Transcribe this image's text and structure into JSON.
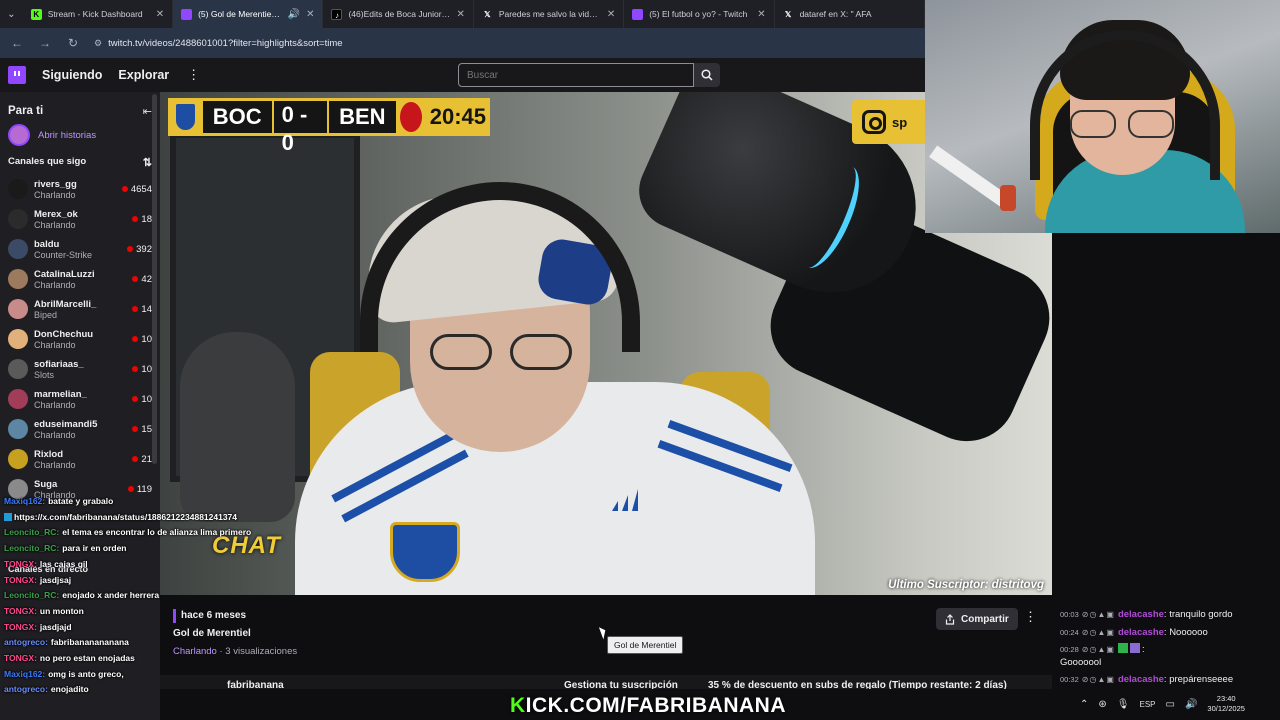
{
  "browser": {
    "tabs": [
      {
        "title": "Stream - Kick Dashboard",
        "icon": "kick-favicon",
        "active": false
      },
      {
        "title": "(5) Gol de Merentiel - Twitch",
        "icon": "twitch-favicon",
        "active": true
      },
      {
        "title": "(46)Edits de Boca Juniors y River",
        "icon": "tiktok-favicon",
        "active": false
      },
      {
        "title": "Paredes me salvo la vida en X: '",
        "icon": "x-favicon",
        "active": false
      },
      {
        "title": "(5) El futbol o yo? - Twitch",
        "icon": "twitch-favicon",
        "active": false
      },
      {
        "title": "dataref en X: \" AFA",
        "icon": "x-favicon",
        "active": false
      }
    ],
    "url": "twitch.tv/videos/2488601001?filter=highlights&sort=time"
  },
  "topnav": {
    "following": "Siguiendo",
    "browse": "Explorar",
    "search_placeholder": "Buscar"
  },
  "sidebar": {
    "for_you": "Para ti",
    "stories": "Abrir historias",
    "followed_header": "Canales que sigo",
    "live_header": "Canales en directo",
    "channels": [
      {
        "name": "rivers_gg",
        "game": "Charlando",
        "viewers": "4654",
        "color": "#1a1a1a"
      },
      {
        "name": "Merex_ok",
        "game": "Charlando",
        "viewers": "18",
        "color": "#2b2b2b"
      },
      {
        "name": "baldu",
        "game": "Counter-Strike",
        "viewers": "392",
        "color": "#3b4a66"
      },
      {
        "name": "CatalinaLuzzi",
        "game": "Charlando",
        "viewers": "42",
        "color": "#9c7a5e"
      },
      {
        "name": "AbrilMarcelli_",
        "game": "Biped",
        "viewers": "14",
        "color": "#c98a8a"
      },
      {
        "name": "DonChechuu",
        "game": "Charlando",
        "viewers": "10",
        "color": "#e2b07a"
      },
      {
        "name": "sofiariaas_",
        "game": "Slots",
        "viewers": "10",
        "color": "#5a5a5a"
      },
      {
        "name": "marmelian_",
        "game": "Charlando",
        "viewers": "10",
        "color": "#a13d59"
      },
      {
        "name": "eduseimandi5",
        "game": "Charlando",
        "viewers": "15",
        "color": "#5c86a3"
      },
      {
        "name": "Rixlod",
        "game": "Charlando",
        "viewers": "21",
        "color": "#c7a020"
      },
      {
        "name": "Suga",
        "game": "Charlando",
        "viewers": "119",
        "color": "#8a8a8a"
      }
    ]
  },
  "video": {
    "scoreboard": {
      "home": "BOC",
      "score": "0 - 0",
      "away": "BEN",
      "clock": "20:45"
    },
    "chat_label": "CHAT",
    "last_sub": "Ultimo Suscriptor: distritovg"
  },
  "video_info": {
    "age": "hace 6 meses",
    "title": "Gol de Merentiel",
    "category": "Charlando",
    "views": "3 visualizaciones",
    "share": "Compartir",
    "tooltip": "Gol de Merentiel",
    "channel_name": "fabribanana",
    "subscribe": "Gestiona tu suscripción",
    "gift_offer": "35 % de descuento en subs de regalo (Tiempo restante: 2 días)"
  },
  "overlay_chat": [
    {
      "user": "Maxiq162:",
      "msg": "batate y grabalo",
      "color": "#3b7bff"
    },
    {
      "user": "",
      "msg": "https://x.com/fabribanana/status/1886212234881241374",
      "color": "#ffffff"
    },
    {
      "user": "Leoncito_RC:",
      "msg": "el tema es encontrar lo de alianza lima primero",
      "color": "#3aa14a"
    },
    {
      "user": "Leoncito_RC:",
      "msg": "para ir en orden",
      "color": "#3aa14a"
    },
    {
      "user": "TONGX:",
      "msg": "las cajas gil",
      "color": "#ff4a8b"
    },
    {
      "user": "TONGX:",
      "msg": "jasdjsaj",
      "color": "#ff4a8b"
    },
    {
      "user": "Leoncito_RC:",
      "msg": "enojado x ander herrera",
      "color": "#3aa14a"
    },
    {
      "user": "TONGX:",
      "msg": "un monton",
      "color": "#ff4a8b"
    },
    {
      "user": "TONGX:",
      "msg": "jasdjajd",
      "color": "#ff4a8b"
    },
    {
      "user": "antogreco:",
      "msg": "fabribananananana",
      "color": "#6a8cff"
    },
    {
      "user": "TONGX:",
      "msg": "no pero estan enojadas",
      "color": "#ff4a8b"
    },
    {
      "user": "Maxiq162:",
      "msg": "omg is anto greco,",
      "color": "#3b7bff"
    },
    {
      "user": "antogreco:",
      "msg": "enojadito",
      "color": "#6a8cff"
    }
  ],
  "right_chat": [
    {
      "time": "00:03",
      "user": "delacashe",
      "msg": "tranquilo gordo"
    },
    {
      "time": "00:24",
      "user": "delacashe",
      "msg": "Noooooo"
    },
    {
      "time": "00:28",
      "user": "",
      "msg": "Gooooool"
    },
    {
      "time": "00:32",
      "user": "delacashe",
      "msg": "prepárenseeee"
    }
  ],
  "kick_banner": {
    "prefix": "K",
    "rest": "ICK.COM/FABRIBANANA"
  },
  "taskbar": {
    "lang": "ESP",
    "time": "23:40",
    "date": "30/12/2025"
  }
}
